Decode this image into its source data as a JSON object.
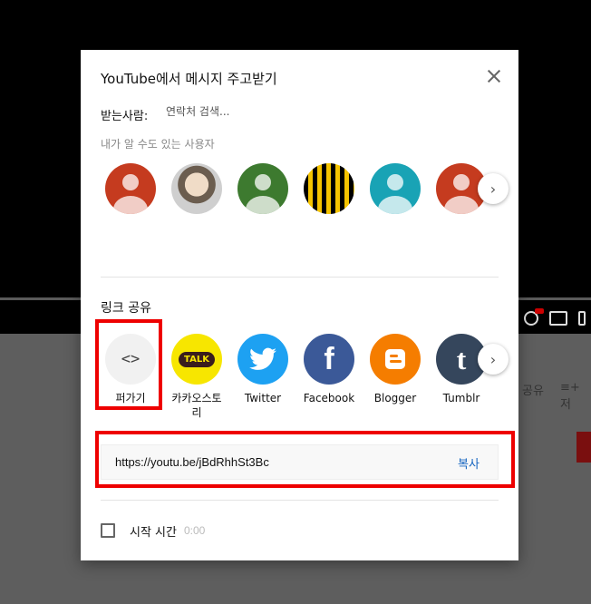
{
  "background": {
    "share_partial": "공유",
    "add_partial": "저"
  },
  "dialog": {
    "title": "YouTube에서 메시지 주고받기",
    "to_label": "받는사람:",
    "to_placeholder": "연락처 검색...",
    "contacts_label": "내가 알 수도 있는 사용자",
    "contacts": [
      {
        "type": "default-avatar",
        "color": "#c53b1f"
      },
      {
        "type": "photo-avatar"
      },
      {
        "type": "default-avatar",
        "color": "#3d7a2f"
      },
      {
        "type": "pattern-avatar",
        "color": "#f5c400"
      },
      {
        "type": "default-avatar",
        "color": "#19a3b5"
      },
      {
        "type": "default-avatar",
        "color": "#c53b1f"
      }
    ],
    "link_share_label": "링크 공유",
    "share_targets": [
      {
        "label": "퍼가기",
        "icon": "embed-icon"
      },
      {
        "label": "카카오스토리",
        "icon": "kakao-talk-icon",
        "badge": "TALK"
      },
      {
        "label": "Twitter",
        "icon": "twitter-icon"
      },
      {
        "label": "Facebook",
        "icon": "facebook-icon",
        "glyph": "f"
      },
      {
        "label": "Blogger",
        "icon": "blogger-icon"
      },
      {
        "label": "Tumblr",
        "icon": "tumblr-icon",
        "glyph": "t"
      }
    ],
    "embed_glyph": "<>",
    "url": "https://youtu.be/jBdRhhSt3Bc",
    "copy_label": "복사",
    "start_time_label": "시작 시간",
    "start_time_value": "0:00"
  },
  "colors": {
    "highlight": "#e00000",
    "link_blue": "#1565c0"
  }
}
